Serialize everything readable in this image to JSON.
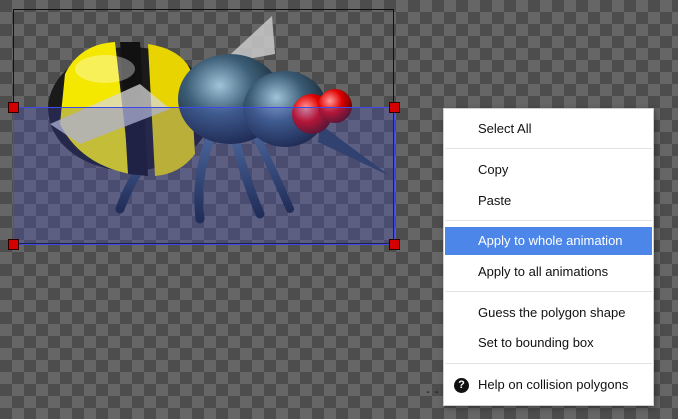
{
  "context_menu": {
    "items": [
      {
        "label": "Select All"
      },
      {
        "label": "Copy"
      },
      {
        "label": "Paste"
      },
      {
        "label": "Apply to whole animation",
        "highlighted": true
      },
      {
        "label": "Apply to all animations"
      },
      {
        "label": "Guess the polygon shape"
      },
      {
        "label": "Set to bounding box"
      },
      {
        "label": "Help on collision polygons",
        "icon": "help-icon"
      }
    ],
    "help_icon_glyph": "?"
  },
  "colors": {
    "highlight": "#4c86e9",
    "polygon_outline": "#3d49e8",
    "handle": "#d40000"
  }
}
